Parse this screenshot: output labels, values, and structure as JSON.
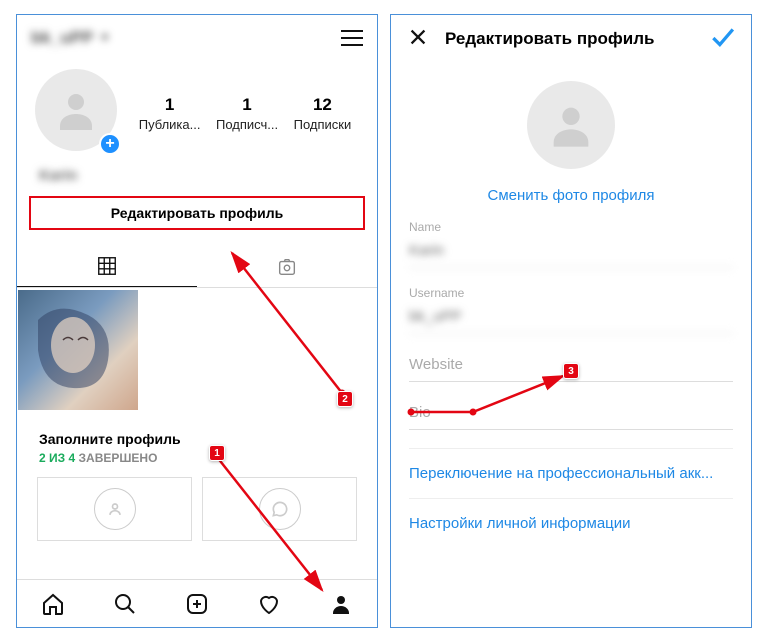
{
  "left": {
    "username": "bk_uPP",
    "stats": [
      {
        "count": "1",
        "label": "Публика..."
      },
      {
        "count": "1",
        "label": "Подписч..."
      },
      {
        "count": "12",
        "label": "Подписки"
      }
    ],
    "display_name": "Karin",
    "edit_button": "Редактировать профиль",
    "complete": {
      "title": "Заполните профиль",
      "progress": "2 ИЗ 4",
      "done": "ЗАВЕРШЕНО"
    }
  },
  "right": {
    "header_title": "Редактировать профиль",
    "change_photo": "Сменить фото профиля",
    "fields": {
      "name": {
        "label": "Name",
        "value": "Karin"
      },
      "username": {
        "label": "Username",
        "value": "bk_uPP"
      },
      "website": {
        "label": "Website",
        "value": ""
      },
      "bio": {
        "label": "Bio",
        "value": ""
      }
    },
    "links": {
      "pro": "Переключение на профессиональный акк...",
      "personal": "Настройки личной информации"
    }
  },
  "markers": {
    "m1": "1",
    "m2": "2",
    "m3": "3"
  }
}
